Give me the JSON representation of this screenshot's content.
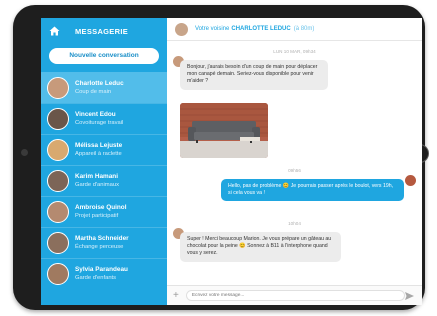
{
  "sidebar": {
    "title": "MESSAGERIE",
    "new_conversation": "Nouvelle conversation",
    "contacts": [
      {
        "name": "Charlotte Leduc",
        "subtitle": "Coup de main",
        "avatar_color": "#c79a7b"
      },
      {
        "name": "Vincent Edou",
        "subtitle": "Covoiturage travail",
        "avatar_color": "#6a5649"
      },
      {
        "name": "Mélissa Lejuste",
        "subtitle": "Appareil à raclette",
        "avatar_color": "#d8a96f"
      },
      {
        "name": "Karim Hamani",
        "subtitle": "Garde d'animaux",
        "avatar_color": "#7c6557"
      },
      {
        "name": "Ambroise Quinol",
        "subtitle": "Projet participatif",
        "avatar_color": "#b48a70"
      },
      {
        "name": "Martha Schneider",
        "subtitle": "Échange perceuse",
        "avatar_color": "#8b6f5d"
      },
      {
        "name": "Sylvia Parandeau",
        "subtitle": "Garde d'enfants",
        "avatar_color": "#a07a60"
      }
    ]
  },
  "chat": {
    "header_prefix": "Votre voisine",
    "header_name": "CHARLOTTE LEDUC",
    "header_sub": "(à 80m)",
    "messages": [
      {
        "timestamp": "LUN 10 MAR, 09h34",
        "text": "Bonjour, j'aurais besoin d'un coup de main pour déplacer mon canapé demain. Seriez-vous disponible pour venir m'aider ?"
      },
      {
        "timestamp": "09h56",
        "text": "Hello, pas de problème 😊 Je pourrais passer après le boulot, vers 19h, si cela vous va !"
      },
      {
        "timestamp": "10h04",
        "text": "Super ! Merci beaucoup Marion. Je vous prépare un gâteau au chocolat pour la peine 😊 Sonnez à B11 à l'interphone quand vous y serez."
      }
    ],
    "composer_placeholder": "Écrivez votre message..."
  },
  "colors": {
    "accent": "#1fa6e0",
    "active_item": "#52bdea",
    "incoming": "#ececec"
  },
  "icons": [
    "home-icon",
    "plus-icon",
    "send-icon"
  ]
}
